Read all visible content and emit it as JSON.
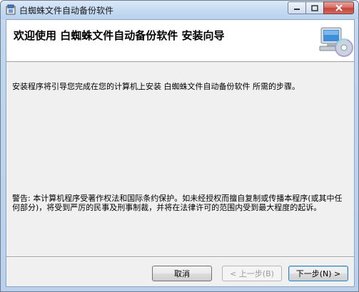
{
  "window": {
    "title": "白蜘蛛文件自动备份软件"
  },
  "banner": {
    "title": "欢迎使用 白蜘蛛文件自动备份软件 安装向导"
  },
  "body": {
    "intro": "安装程序将引导您完成在您的计算机上安装 白蜘蛛文件自动备份软件 所需的步骤。",
    "warning": "警告: 本计算机程序受著作权法和国际条约保护。如未经授权而擅自复制或传播本程序(或其中任何部分)，将受到严厉的民事及刑事制裁，并将在法律许可的范围内受到最大程度的起诉。"
  },
  "buttons": {
    "cancel": "取消",
    "back": "< 上一步(B)",
    "next": "下一步(N) >"
  },
  "icons": {
    "app": "installer-icon",
    "banner": "computer-cd-icon"
  }
}
